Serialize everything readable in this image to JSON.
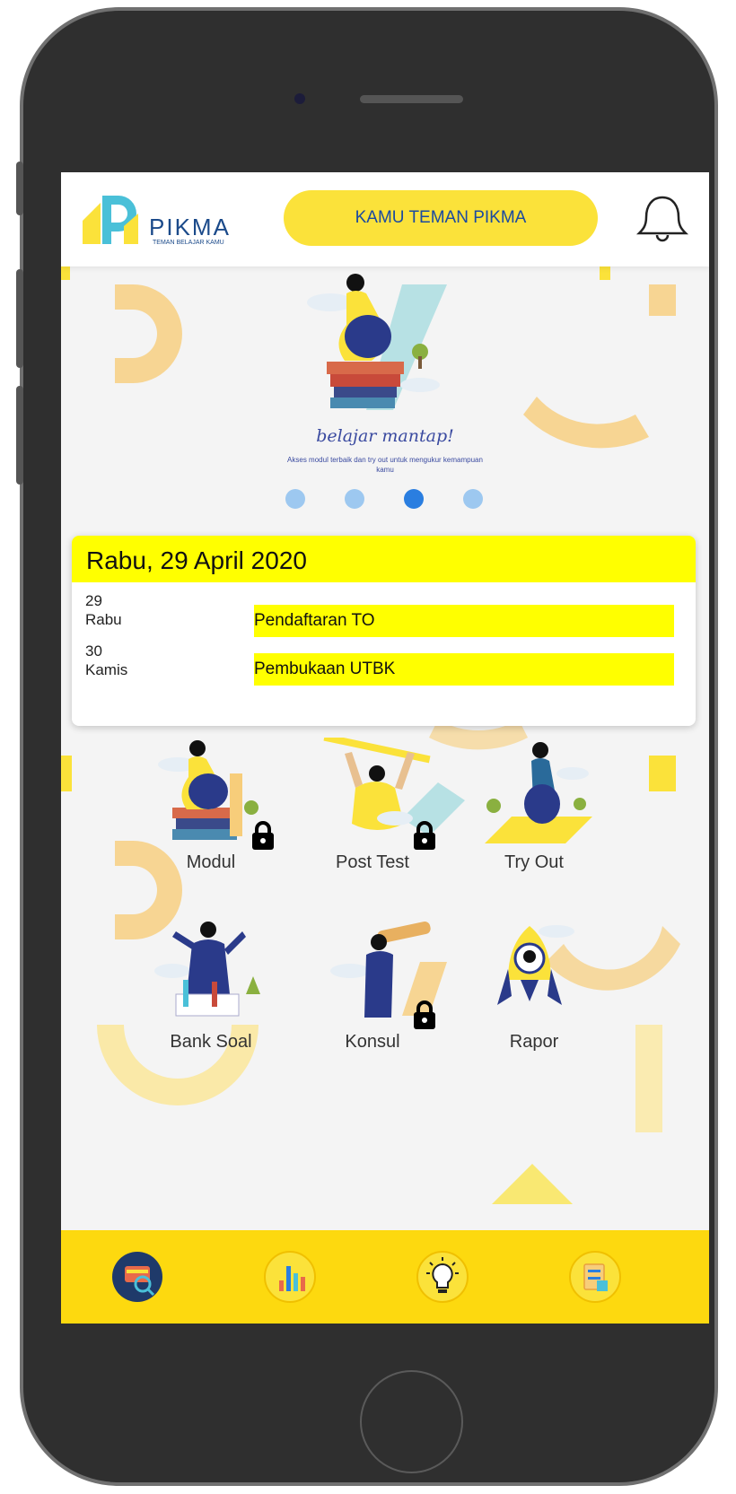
{
  "header": {
    "logo_text": "PIKMA",
    "logo_tagline": "TEMAN BELAJAR KAMU",
    "greeting_button": "KAMU TEMAN PIKMA"
  },
  "banner": {
    "title": "belajar mantap!",
    "subtitle": "Akses modul terbaik dan try out untuk mengukur kemampuan kamu",
    "slides_total": 4,
    "active_slide": 3
  },
  "schedule": {
    "date_title": "Rabu, 29 April 2020",
    "events": [
      {
        "day_num": "29",
        "day_name": "Rabu",
        "label": "Pendaftaran TO"
      },
      {
        "day_num": "30",
        "day_name": "Kamis",
        "label": "Pembukaan UTBK"
      }
    ]
  },
  "menu": [
    {
      "label": "Modul",
      "locked": true
    },
    {
      "label": "Post Test",
      "locked": true
    },
    {
      "label": "Try Out",
      "locked": false
    },
    {
      "label": "Bank Soal",
      "locked": false
    },
    {
      "label": "Konsul",
      "locked": true
    },
    {
      "label": "Rapor",
      "locked": false
    }
  ],
  "nav": [
    {
      "icon": "search-module-icon",
      "active": true
    },
    {
      "icon": "bar-chart-icon",
      "active": false
    },
    {
      "icon": "lightbulb-icon",
      "active": false
    },
    {
      "icon": "report-icon",
      "active": false
    }
  ],
  "colors": {
    "accent_yellow": "#fbe23a",
    "highlight_yellow": "#ffff00",
    "navbar_yellow": "#fdd90f",
    "brand_blue": "#1b4a8a",
    "dot_active": "#2a7ee0",
    "dot_inactive": "#9dc8f0"
  }
}
